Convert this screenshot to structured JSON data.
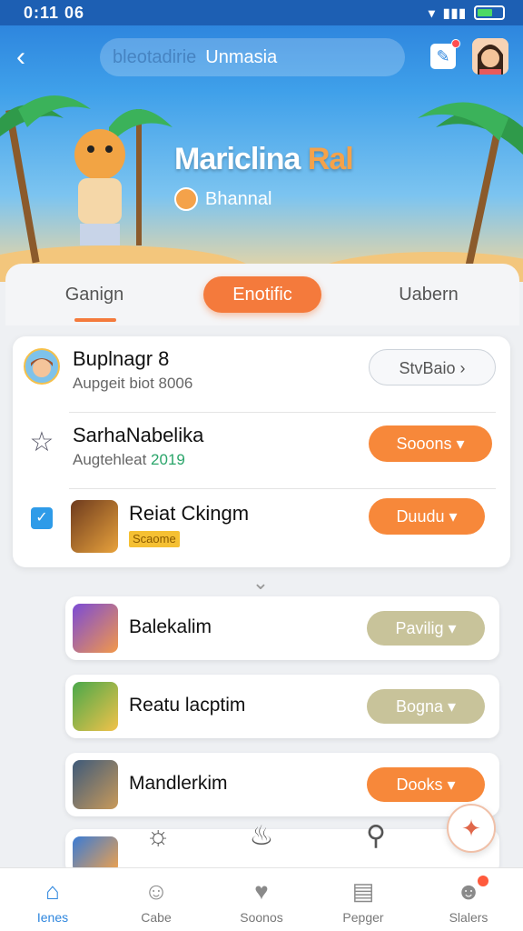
{
  "status_bar": {
    "time": "0:11 06"
  },
  "header": {
    "search_faded_text": "bleotadirie",
    "search_text": "Unmasia",
    "icons": {
      "back": "chevron-left-icon",
      "edit": "edit-note-icon",
      "avatar": "user-avatar"
    }
  },
  "banner": {
    "title_main": "Mariclina",
    "title_accent": "Ral",
    "subtitle": "Bhannal"
  },
  "tabs": [
    {
      "label": "Ganign"
    },
    {
      "label": "Enotific"
    },
    {
      "label": "Uabern"
    }
  ],
  "main_list": [
    {
      "title": "Buplnagr 8",
      "subtitle": "Aupgeit biot 8006",
      "button": "StvBaio"
    },
    {
      "title": "SarhaNabelika",
      "subtitle_prefix": "Augtehleat",
      "subtitle_value": "2019",
      "button": "Sooons"
    },
    {
      "title": "Reiat Ckingm",
      "badge": "Scaome",
      "button": "Duudu"
    }
  ],
  "game_list": [
    {
      "title": "Balekalim",
      "button": "Pavilig"
    },
    {
      "title": "Reatu lacptim",
      "button": "Bogna"
    },
    {
      "title": "Mandlerkim",
      "button": "Dooks"
    }
  ],
  "bottom_nav": [
    {
      "label": "Ienes",
      "icon": "home-icon"
    },
    {
      "label": "Cabe",
      "icon": "face-icon"
    },
    {
      "label": "Soonos",
      "icon": "heart-icon"
    },
    {
      "label": "Pepger",
      "icon": "calendar-icon"
    },
    {
      "label": "Slalers",
      "icon": "users-icon"
    }
  ],
  "colors": {
    "primary": "#2e86de",
    "accent": "#f7883a",
    "khaki": "#c8c39a"
  }
}
